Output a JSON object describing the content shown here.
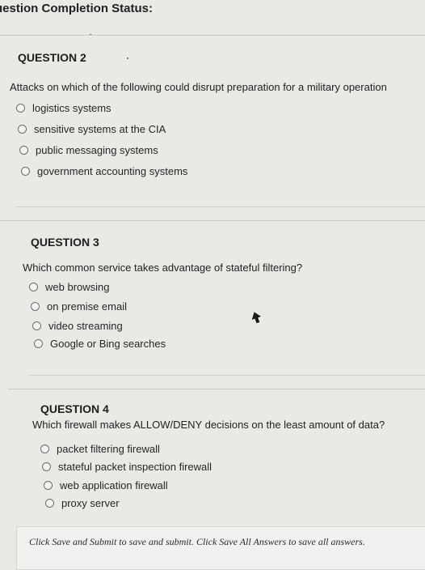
{
  "header": {
    "title": "uestion Completion Status:"
  },
  "questions": [
    {
      "number_label": "QUESTION 2",
      "text": "Attacks on which of the following could disrupt preparation for a military operation",
      "options": [
        "logistics systems",
        "sensitive systems at the CIA",
        "public messaging systems",
        "government accounting systems"
      ]
    },
    {
      "number_label": "QUESTION 3",
      "text": "Which common service takes advantage of stateful filtering?",
      "options": [
        "web browsing",
        "on premise email",
        "video streaming",
        "Google or Bing searches"
      ]
    },
    {
      "number_label": "QUESTION 4",
      "text": "Which firewall makes ALLOW/DENY decisions on the least amount of data?",
      "options": [
        "packet filtering firewall",
        "stateful packet inspection firewall",
        "web application firewall",
        "proxy server"
      ]
    }
  ],
  "footer": {
    "instructions": "Click Save and Submit to save and submit. Click Save All Answers to save all answers."
  }
}
